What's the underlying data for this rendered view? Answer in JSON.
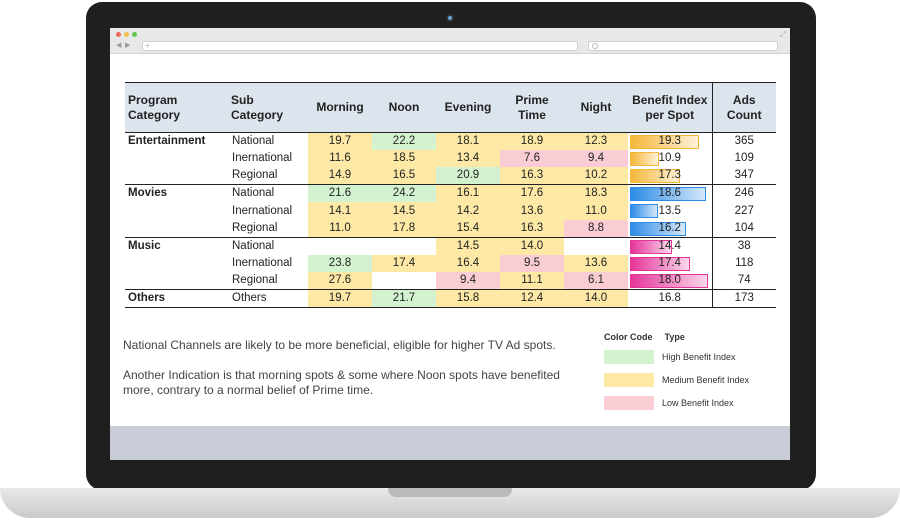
{
  "table": {
    "headers": {
      "program_category": "Program Category",
      "sub_category": "Sub Category",
      "morning": "Morning",
      "noon": "Noon",
      "evening": "Evening",
      "prime_time_l1": "Prime",
      "prime_time_l2": "Time",
      "night": "Night",
      "benefit_l1": "Benefit Index",
      "benefit_l2": "per Spot",
      "ads_count": "Ads Count"
    },
    "rows": [
      {
        "category": "Entertainment",
        "sub": "National",
        "morning": "19.7",
        "noon": "22.2",
        "evening": "18.1",
        "prime": "18.9",
        "night": "12.3",
        "benefit": "19.3",
        "ads": "365"
      },
      {
        "category": "",
        "sub": "Inernational",
        "morning": "11.6",
        "noon": "18.5",
        "evening": "13.4",
        "prime": "7.6",
        "night": "9.4",
        "benefit": "10.9",
        "ads": "109"
      },
      {
        "category": "",
        "sub": "Regional",
        "morning": "14.9",
        "noon": "16.5",
        "evening": "20.9",
        "prime": "16.3",
        "night": "10.2",
        "benefit": "17.3",
        "ads": "347"
      },
      {
        "category": "Movies",
        "sub": "National",
        "morning": "21.6",
        "noon": "24.2",
        "evening": "16.1",
        "prime": "17.6",
        "night": "18.3",
        "benefit": "18.6",
        "ads": "246"
      },
      {
        "category": "",
        "sub": "Inernational",
        "morning": "14.1",
        "noon": "14.5",
        "evening": "14.2",
        "prime": "13.6",
        "night": "11.0",
        "benefit": "13.5",
        "ads": "227"
      },
      {
        "category": "",
        "sub": "Regional",
        "morning": "11.0",
        "noon": "17.8",
        "evening": "15.4",
        "prime": "16.3",
        "night": "8.8",
        "benefit": "16.2",
        "ads": "104"
      },
      {
        "category": "Music",
        "sub": "National",
        "morning": "",
        "noon": "",
        "evening": "14.5",
        "prime": "14.0",
        "night": "",
        "benefit": "14.4",
        "ads": "38"
      },
      {
        "category": "",
        "sub": "Inernational",
        "morning": "23.8",
        "noon": "17.4",
        "evening": "16.4",
        "prime": "9.5",
        "night": "13.6",
        "benefit": "17.4",
        "ads": "118"
      },
      {
        "category": "",
        "sub": "Regional",
        "morning": "27.6",
        "noon": "",
        "evening": "9.4",
        "prime": "11.1",
        "night": "6.1",
        "benefit": "18.0",
        "ads": "74"
      },
      {
        "category": "Others",
        "sub": "Others",
        "morning": "19.7",
        "noon": "21.7",
        "evening": "15.8",
        "prime": "12.4",
        "night": "14.0",
        "benefit": "16.8",
        "ads": "173"
      }
    ]
  },
  "cell_levels": [
    [
      "m",
      "h",
      "m",
      "m",
      "m"
    ],
    [
      "m",
      "m",
      "m",
      "l",
      "l"
    ],
    [
      "m",
      "m",
      "h",
      "m",
      "m"
    ],
    [
      "h",
      "h",
      "m",
      "m",
      "m"
    ],
    [
      "m",
      "m",
      "m",
      "m",
      "m"
    ],
    [
      "m",
      "m",
      "m",
      "m",
      "l"
    ],
    [
      "",
      "",
      "m",
      "m",
      ""
    ],
    [
      "h",
      "m",
      "m",
      "l",
      "m"
    ],
    [
      "m",
      "",
      "l",
      "m",
      "l"
    ],
    [
      "m",
      "h",
      "m",
      "m",
      "m"
    ]
  ],
  "benefit_bars": [
    {
      "fill": 0.86,
      "color": "#f5b73a"
    },
    {
      "fill": 0.36,
      "color": "#f5b73a"
    },
    {
      "fill": 0.62,
      "color": "#f5b73a"
    },
    {
      "fill": 0.95,
      "color": "#2e8be6"
    },
    {
      "fill": 0.35,
      "color": "#2e8be6"
    },
    {
      "fill": 0.7,
      "color": "#2e8be6"
    },
    {
      "fill": 0.52,
      "color": "#e5369a"
    },
    {
      "fill": 0.75,
      "color": "#e5369a"
    },
    {
      "fill": 0.98,
      "color": "#e5369a"
    },
    {
      "fill": 0,
      "color": ""
    }
  ],
  "notes": {
    "line1": "National Channels are likely to be more beneficial, eligible for higher TV Ad spots.",
    "line2": "Another Indication is that morning spots & some where Noon spots have benefited more, contrary to a normal belief of Prime time."
  },
  "legend": {
    "color_code": "Color Code",
    "type": "Type",
    "items": [
      {
        "label": "High Benefit Index",
        "color": "#d3f2cf"
      },
      {
        "label": "Medium Benefit Index",
        "color": "#fde9a5"
      },
      {
        "label": "Low Benefit Index",
        "color": "#f9cdd3"
      }
    ]
  },
  "colors": {
    "high": "#d3f2cf",
    "medium": "#fde9a5",
    "low": "#f9cdd3",
    "header_bg": "#dce4ee"
  }
}
